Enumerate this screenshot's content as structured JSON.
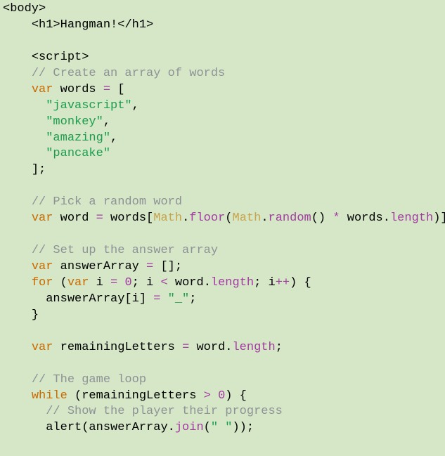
{
  "lines": {
    "l01_body": "<body>",
    "l02_h1a": "<h1>",
    "l02_txt": "Hangman!",
    "l02_h1b": "</h1>",
    "l04_script": "<script>",
    "l05_cmt": "// Create an array of words",
    "l06_var": "var",
    "l06_words": " words ",
    "l06_eq": "=",
    "l06_brk": " [",
    "l07_str": "\"javascript\"",
    "l08_str": "\"monkey\"",
    "l09_str": "\"amazing\"",
    "l10_str": "\"pancake\"",
    "l11_close": "];",
    "l13_cmt": "// Pick a random word",
    "l14_var": "var",
    "l14_word": " word ",
    "l14_eq": "=",
    "l14_words2": " words[",
    "l14_math1": "Math",
    "l14_dot1": ".",
    "l14_floor": "floor",
    "l14_p1": "(",
    "l14_math2": "Math",
    "l14_dot2": ".",
    "l14_random": "random",
    "l14_p2": "() ",
    "l14_mul": "*",
    "l14_words3": " words",
    "l14_dot3": ".",
    "l14_len": "length",
    "l14_end": ")];",
    "l16_cmt": "// Set up the answer array",
    "l17_var": "var",
    "l17_aa": " answerArray ",
    "l17_eq": "=",
    "l17_arr": " [];",
    "l18_for": "for",
    "l18_p1": " (",
    "l18_var": "var",
    "l18_i": " i ",
    "l18_eq": "=",
    "l18_sp": " ",
    "l18_zero": "0",
    "l18_semi": "; i ",
    "l18_lt": "<",
    "l18_word": " word",
    "l18_dot": ".",
    "l18_len": "length",
    "l18_semi2": "; i",
    "l18_pp": "++",
    "l18_end": ") {",
    "l19_aa": "answerArray[i] ",
    "l19_eq": "=",
    "l19_sp": " ",
    "l19_us": "\"_\"",
    "l19_semi": ";",
    "l20_brace": "}",
    "l22_var": "var",
    "l22_rem": " remainingLetters ",
    "l22_eq": "=",
    "l22_word": " word",
    "l22_dot": ".",
    "l22_len": "length",
    "l22_semi": ";",
    "l24_cmt": "// The game loop",
    "l25_while": "while",
    "l25_p1": " (remainingLetters ",
    "l25_gt": ">",
    "l25_sp": " ",
    "l25_zero": "0",
    "l25_end": ") {",
    "l26_cmt": "// Show the player their progress",
    "l27_alert": "alert(answerArray",
    "l27_dot": ".",
    "l27_join": "join",
    "l27_p1": "(",
    "l27_sp": "\" \"",
    "l27_end": "));"
  }
}
